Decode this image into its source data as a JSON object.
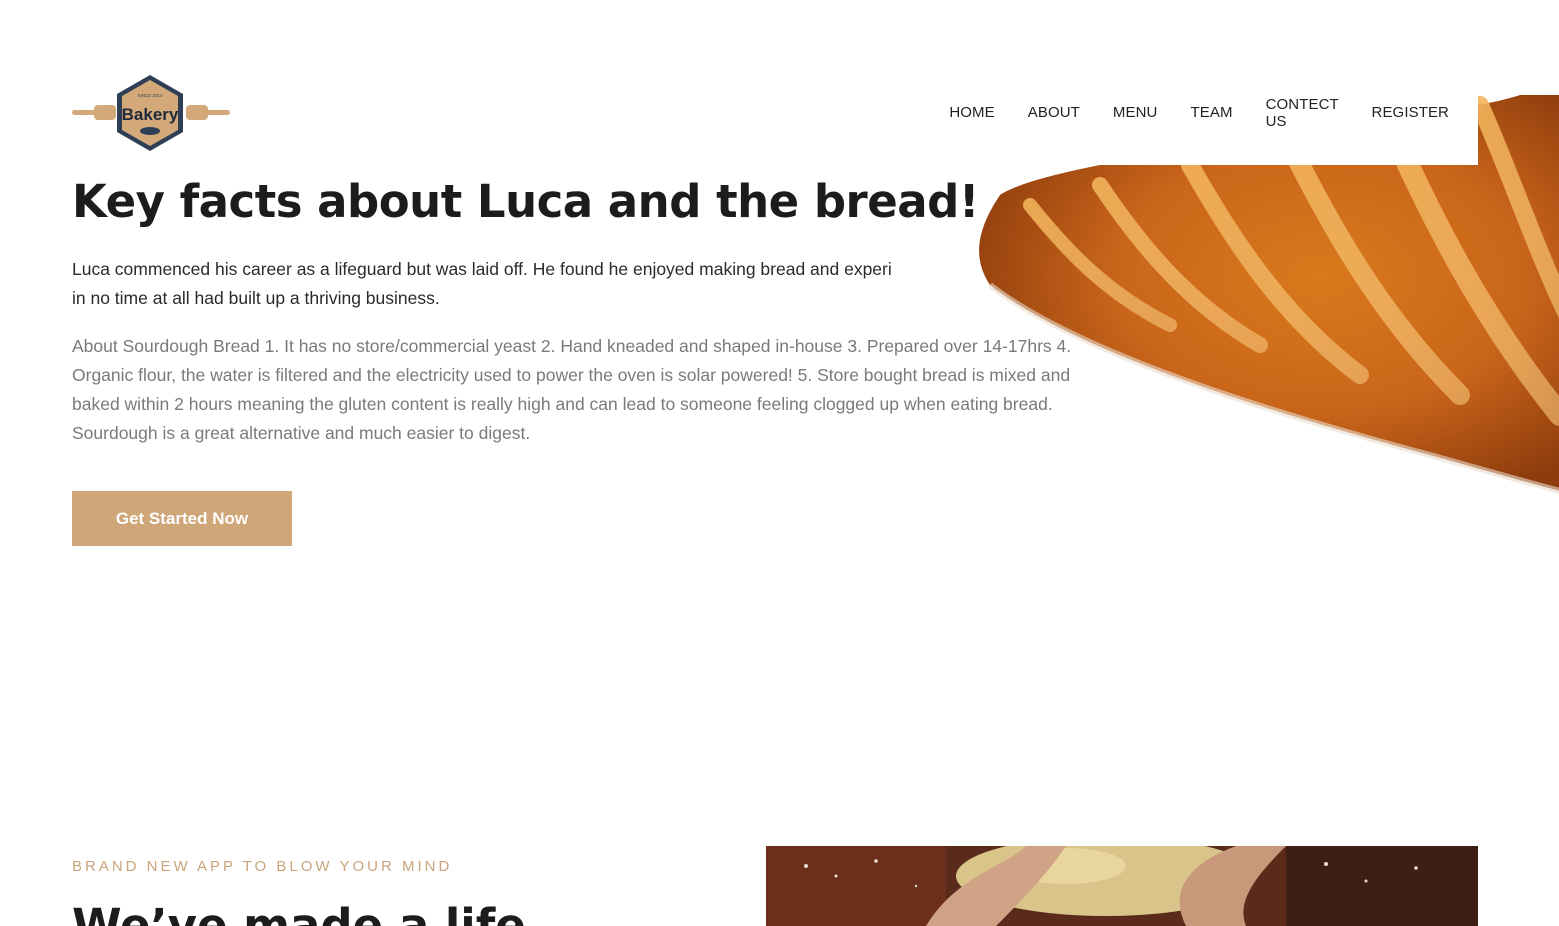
{
  "brand": {
    "logo_text": "Bakery",
    "logo_tagline": "SINCE 2014"
  },
  "nav": {
    "items": [
      "HOME",
      "ABOUT",
      "MENU",
      "TEAM",
      "CONTECT US",
      "REGISTER"
    ]
  },
  "hero": {
    "title": "Key facts about Luca and the bread!",
    "lead_line1": "Luca commenced his career as a lifeguard but was laid off. He found he enjoyed making bread and experi",
    "lead_line2": "in no time at all had built up a thriving business.",
    "description": "About Sourdough Bread 1. It has no store/commercial yeast 2. Hand kneaded and shaped in-house 3. Prepared over 14-17hrs 4. Organic flour, the water is filtered and the electricity used to power the oven is solar powered! 5. Store bought bread is mixed and baked within 2 hours meaning the gluten content is really high and can lead to someone feeling clogged up when eating bread. Sourdough is a great alternative and much easier to digest.",
    "cta_label": "Get Started Now"
  },
  "section2": {
    "eyebrow": "BRAND NEW APP TO BLOW YOUR MIND",
    "title": "We’ve made a life"
  },
  "colors": {
    "accent": "#cfa678",
    "eyebrow": "#c9a47c",
    "logo_badge": "#2e3f55"
  }
}
